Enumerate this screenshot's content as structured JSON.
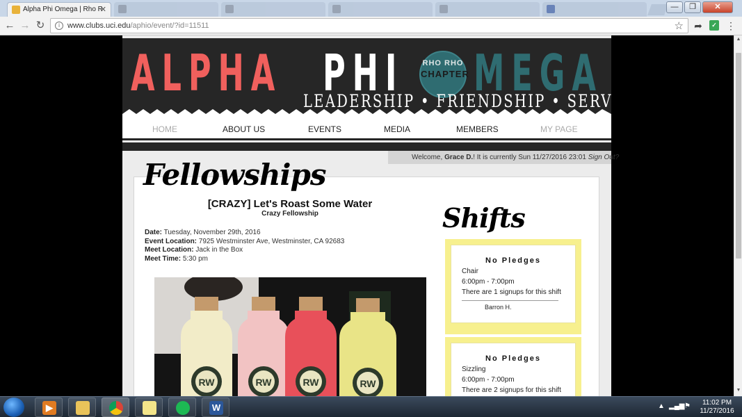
{
  "browser": {
    "active_tab_title": "Alpha Phi Omega | Rho R",
    "inactive_tabs": [
      "",
      "",
      "",
      "",
      "",
      "",
      "",
      ""
    ],
    "url_host": "www.clubs.uci.edu",
    "url_path": "/aphio/event/?id=11511",
    "window_buttons": {
      "minimize": "—",
      "restore": "❐",
      "close": "✕"
    }
  },
  "banner": {
    "word_alpha": "ALPHA",
    "word_phi": "PHI",
    "word_mega": "MEGA",
    "seal_top": "RHO RHO",
    "seal_bottom": "CHAPTER",
    "motto": "LEADERSHIP • FRIENDSHIP • SERVICE"
  },
  "nav": {
    "items": [
      "HOME",
      "ABOUT US",
      "EVENTS",
      "MEDIA",
      "MEMBERS",
      "MY PAGE"
    ]
  },
  "welcome": {
    "prefix": "Welcome, ",
    "user": "Grace D.",
    "middle": "! It is currently Sun 11/27/2016 23:01 ",
    "signout": "Sign Out?"
  },
  "page": {
    "section_heading": "Fellowships",
    "shifts_heading": "Shifts"
  },
  "event": {
    "title": "[CRAZY] Let's Roast Some Water",
    "subtitle": "Crazy Fellowship",
    "date_label": "Date:",
    "date_value": "Tuesday, November 29th, 2016",
    "location_label": "Event Location:",
    "location_value": "7925 Westminster Ave, Westminster, CA 92683",
    "meet_location_label": "Meet Location:",
    "meet_location_value": "Jack in the Box",
    "meet_time_label": "Meet Time:",
    "meet_time_value": "5:30 pm",
    "bottle_label": "RW"
  },
  "shifts": [
    {
      "title": "No Pledges",
      "role": "Chair",
      "time": "6:00pm - 7:00pm",
      "signups": "There are 1 signups for this shift",
      "names": [
        "Barron H."
      ]
    },
    {
      "title": "No Pledges",
      "role": "Sizzling",
      "time": "6:00pm - 7:00pm",
      "signups": "There are 2 signups for this shift",
      "names": []
    }
  ],
  "taskbar": {
    "time": "11:02 PM",
    "date": "11/27/2016",
    "word_glyph": "W"
  },
  "colors": {
    "alpha_red": "#f0605d",
    "mega_teal": "#2f6c71",
    "banner_dark": "#262626",
    "shift_yellow": "#f7f08e"
  }
}
